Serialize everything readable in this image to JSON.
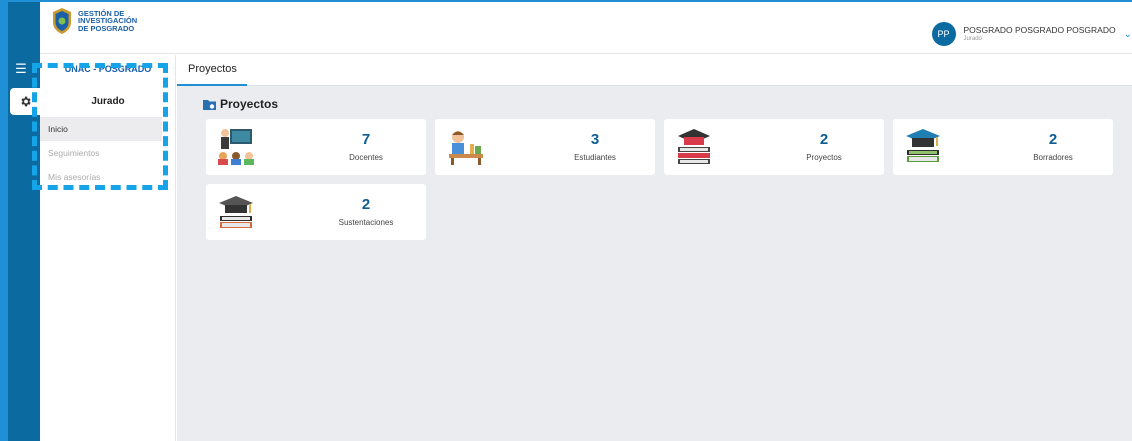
{
  "header": {
    "logo_lines": [
      "GESTIÓN DE",
      "INVESTIGACIÓN",
      "DE POSGRADO"
    ],
    "user": {
      "initials": "PP",
      "name": "POSGRADO POSGRADO POSGRADO",
      "role": "Jurado"
    }
  },
  "sidebar": {
    "title": "UNAC - POSGRADO",
    "section": "Jurado",
    "items": [
      {
        "label": "Inicio",
        "active": true
      },
      {
        "label": "Seguimientos",
        "active": false
      },
      {
        "label": "Mis asesorías",
        "active": false
      }
    ]
  },
  "main": {
    "tab": "Proyectos",
    "section_title": "Proyectos",
    "cards": [
      {
        "value": "7",
        "label": "Docentes",
        "icon": "teacher-icon"
      },
      {
        "value": "3",
        "label": "Estudiantes",
        "icon": "student-icon"
      },
      {
        "value": "2",
        "label": "Proyectos",
        "icon": "books-cap-icon"
      },
      {
        "value": "2",
        "label": "Borradores",
        "icon": "graduation-cap-icon"
      },
      {
        "value": "2",
        "label": "Sustentaciones",
        "icon": "cap-book-icon"
      }
    ]
  },
  "colors": {
    "primary": "#1f8fd6",
    "rail": "#0b6aa0",
    "accent_number": "#0d5d92",
    "highlight": "#16a4e8",
    "background": "#ebecf0"
  }
}
